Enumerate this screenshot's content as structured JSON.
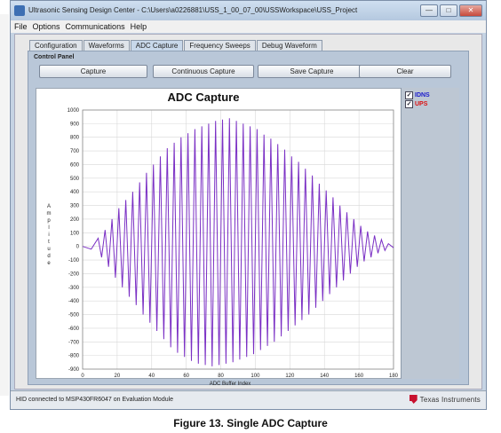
{
  "window": {
    "title": "Ultrasonic Sensing Design Center - C:\\Users\\a0226881\\USS_1_00_07_00\\USSWorkspace\\USS_Project",
    "buttons": [
      "minimize",
      "maximize",
      "close"
    ]
  },
  "menu": [
    "File",
    "Options",
    "Communications",
    "Help"
  ],
  "tabs": [
    "Configuration",
    "Waveforms",
    "ADC Capture",
    "Frequency Sweeps",
    "Debug Waveform"
  ],
  "active_tab": "ADC Capture",
  "control_panel": {
    "label": "Control Panel",
    "buttons": [
      "Capture",
      "Continuous Capture",
      "Save Capture",
      "Clear"
    ]
  },
  "legend": [
    {
      "label": "IDNS",
      "color": "#1a1acc",
      "checked": true
    },
    {
      "label": "UPS",
      "color": "#dd1111",
      "checked": true
    }
  ],
  "colors": {
    "series": "#7a2fc4",
    "grid": "#d8d8d8"
  },
  "status": {
    "text": "HID connected to MSP430FR6047 on Evaluation Module",
    "logo_text": "Texas Instruments"
  },
  "caption": "Figure 13. Single ADC Capture",
  "chart_data": {
    "type": "line",
    "title": "ADC Capture",
    "xlabel": "ADC Buffer Index",
    "ylabel": "Amplitude",
    "xlim": [
      0,
      180
    ],
    "ylim": [
      -900,
      1000
    ],
    "x_ticks": [
      0,
      20,
      40,
      60,
      80,
      100,
      120,
      140,
      160,
      180
    ],
    "y_ticks": [
      1000,
      900,
      800,
      700,
      600,
      500,
      400,
      300,
      200,
      100,
      0,
      -100,
      -200,
      -300,
      -400,
      -500,
      -600,
      -700,
      -800,
      -900
    ],
    "grid": true,
    "series": [
      {
        "x": [
          0,
          5,
          9,
          11,
          13,
          15,
          17,
          19,
          21,
          23,
          25,
          27,
          29,
          31,
          33,
          35,
          37,
          39,
          41,
          43,
          45,
          47,
          49,
          51,
          53,
          55,
          57,
          59,
          61,
          63,
          65,
          67,
          69,
          71,
          73,
          75,
          77,
          79,
          81,
          83,
          85,
          87,
          89,
          91,
          93,
          95,
          97,
          99,
          101,
          103,
          105,
          107,
          109,
          111,
          113,
          115,
          117,
          119,
          121,
          123,
          125,
          127,
          129,
          131,
          133,
          135,
          137,
          139,
          141,
          143,
          145,
          147,
          149,
          151,
          153,
          155,
          157,
          159,
          161,
          163,
          165,
          167,
          169,
          171,
          173,
          175,
          177,
          180
        ],
        "y": [
          0,
          -20,
          60,
          -80,
          120,
          -150,
          200,
          -230,
          280,
          -300,
          340,
          -370,
          400,
          -430,
          470,
          -500,
          540,
          -560,
          600,
          -620,
          660,
          -680,
          720,
          -740,
          760,
          -780,
          800,
          -810,
          830,
          -840,
          860,
          -860,
          880,
          -870,
          900,
          -880,
          920,
          -870,
          930,
          -860,
          940,
          -850,
          920,
          -830,
          900,
          -810,
          880,
          -790,
          860,
          -760,
          820,
          -730,
          790,
          -700,
          750,
          -660,
          710,
          -620,
          660,
          -580,
          620,
          -540,
          570,
          -500,
          520,
          -450,
          460,
          -400,
          410,
          -350,
          360,
          -300,
          300,
          -250,
          250,
          -200,
          200,
          -150,
          150,
          -110,
          110,
          -80,
          80,
          -50,
          50,
          -30,
          20,
          -10
        ]
      }
    ]
  }
}
